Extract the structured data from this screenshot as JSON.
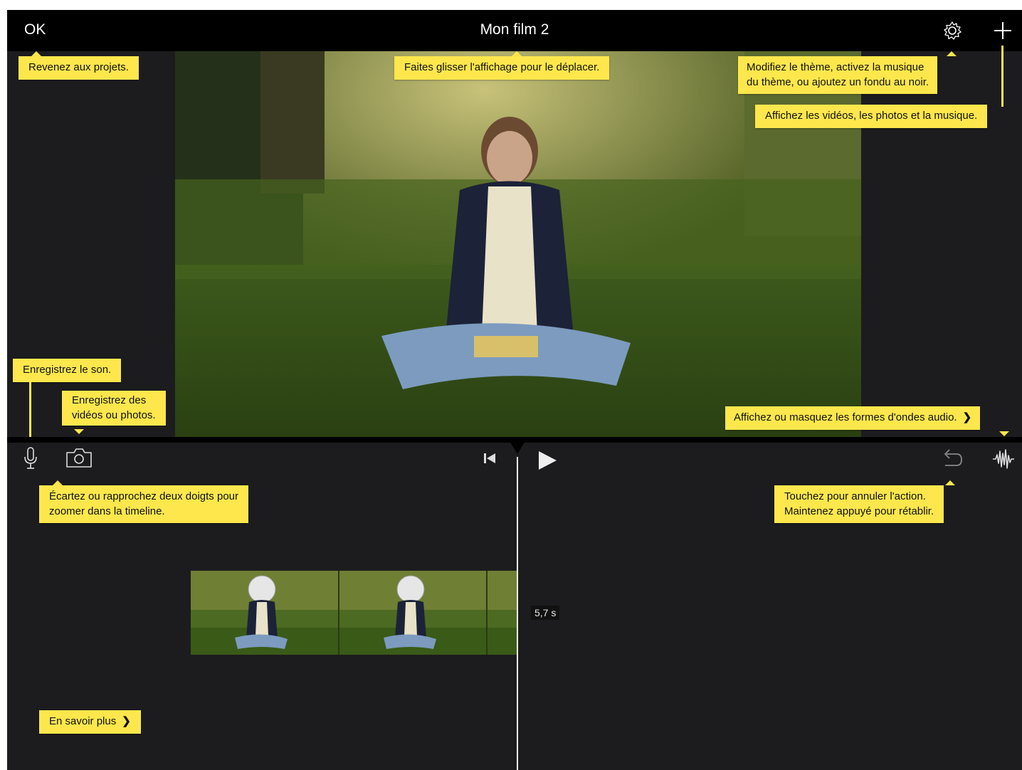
{
  "header": {
    "ok_label": "OK",
    "title": "Mon film 2",
    "settings_icon": "gear-icon",
    "add_icon": "plus-icon"
  },
  "viewer": {
    "content": "photo"
  },
  "tips": {
    "back": "Revenez aux projets.",
    "drag": "Faites glisser l'affichage pour le déplacer.",
    "theme_line1": "Modifiez le thème, activez la musique",
    "theme_line2": "du thème, ou ajoutez un fondu au noir.",
    "media": "Affichez les vidéos, les photos et la musique.",
    "record_audio": "Enregistrez le son.",
    "record_video_line1": "Enregistrez des",
    "record_video_line2": "vidéos ou photos.",
    "waveforms": "Affichez ou masquez les formes d'ondes audio.",
    "zoom_line1": "Écartez ou rapprochez deux doigts pour",
    "zoom_line2": "zoomer dans la timeline.",
    "undo_line1": "Touchez pour annuler l'action.",
    "undo_line2": "Maintenez appuyé pour rétablir.",
    "learn_more": "En savoir plus"
  },
  "controls": {
    "microphone_icon": "microphone-icon",
    "camera_icon": "camera-icon",
    "rewind_icon": "skip-to-start-icon",
    "play_icon": "play-icon",
    "undo_icon": "undo-icon",
    "waveform_icon": "audio-waveform-icon"
  },
  "timeline": {
    "clip_duration": "5,7 s"
  },
  "colors": {
    "tip_background": "#fde74c",
    "timeline_background": "#1c1c1e",
    "bar_background": "#000000"
  }
}
